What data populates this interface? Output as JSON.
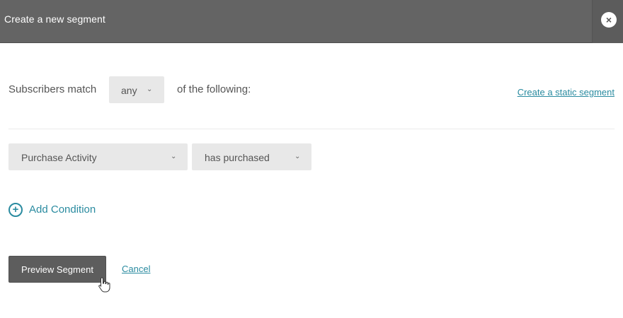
{
  "dialog": {
    "title": "Create a new segment",
    "close_icon": "close-icon",
    "close_glyph": "×"
  },
  "match": {
    "label": "Subscribers match",
    "selected": "any",
    "suffix": "of the following:",
    "static_link": "Create a static segment"
  },
  "condition": {
    "field": "Purchase Activity",
    "operator": "has purchased"
  },
  "add_condition": {
    "label": "Add Condition",
    "icon": "plus-circle-icon"
  },
  "actions": {
    "preview": "Preview Segment",
    "cancel": "Cancel"
  },
  "colors": {
    "header": "#646464",
    "accent": "#2a8ba0",
    "field_bg": "#e8e8e8",
    "primary_button": "#5d5d5d"
  }
}
